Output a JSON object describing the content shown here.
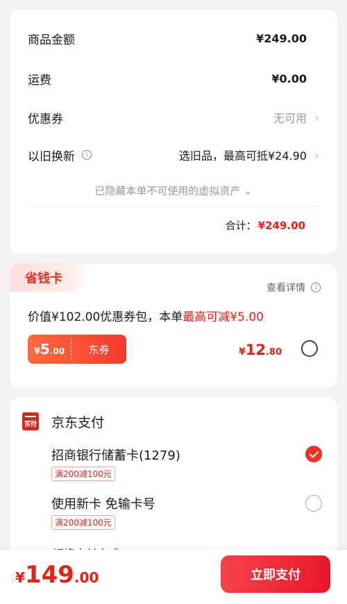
{
  "summary": {
    "goods_amount": {
      "label": "商品金额",
      "value": "¥249.00"
    },
    "shipping": {
      "label": "运费",
      "value": "¥0.00"
    },
    "coupon": {
      "label": "优惠券",
      "value": "无可用"
    },
    "trade_in": {
      "label": "以旧换新",
      "value": "选旧品，最高可抵¥24.90"
    },
    "hidden_note": "已隐藏本单不可使用的虚拟资产",
    "total_label": "合计：",
    "total_value": "¥249.00",
    "chevron": "›",
    "info_icon": "ⓘ"
  },
  "saver_card": {
    "tag": "省钱卡",
    "detail_link": "查看详情",
    "desc_prefix": "价值¥102.00优惠券包，本单",
    "desc_highlight": "最高可减¥5.00",
    "coupon": {
      "currency": "¥",
      "amount_int": "5",
      "amount_dec": ".00",
      "label": "东券"
    },
    "price": {
      "currency": "¥",
      "amount_int": "12",
      "amount_dec": ".80"
    },
    "selected": false
  },
  "payment": {
    "title": "京东支付",
    "logo_text": "东付",
    "methods": [
      {
        "label": "招商银行储蓄卡(1279)",
        "promo": "满200减100元",
        "selected": true
      },
      {
        "label": "使用新卡 免输卡号",
        "promo": "满200减100元",
        "selected": false
      }
    ],
    "switch_label": "切换支付方式 ›"
  },
  "bottom": {
    "currency": "¥",
    "amount_int": "149",
    "amount_dec": ".00",
    "pay_button": "立即支付"
  },
  "colors": {
    "accent": "#e2231a",
    "background": "#f2f2f2"
  }
}
